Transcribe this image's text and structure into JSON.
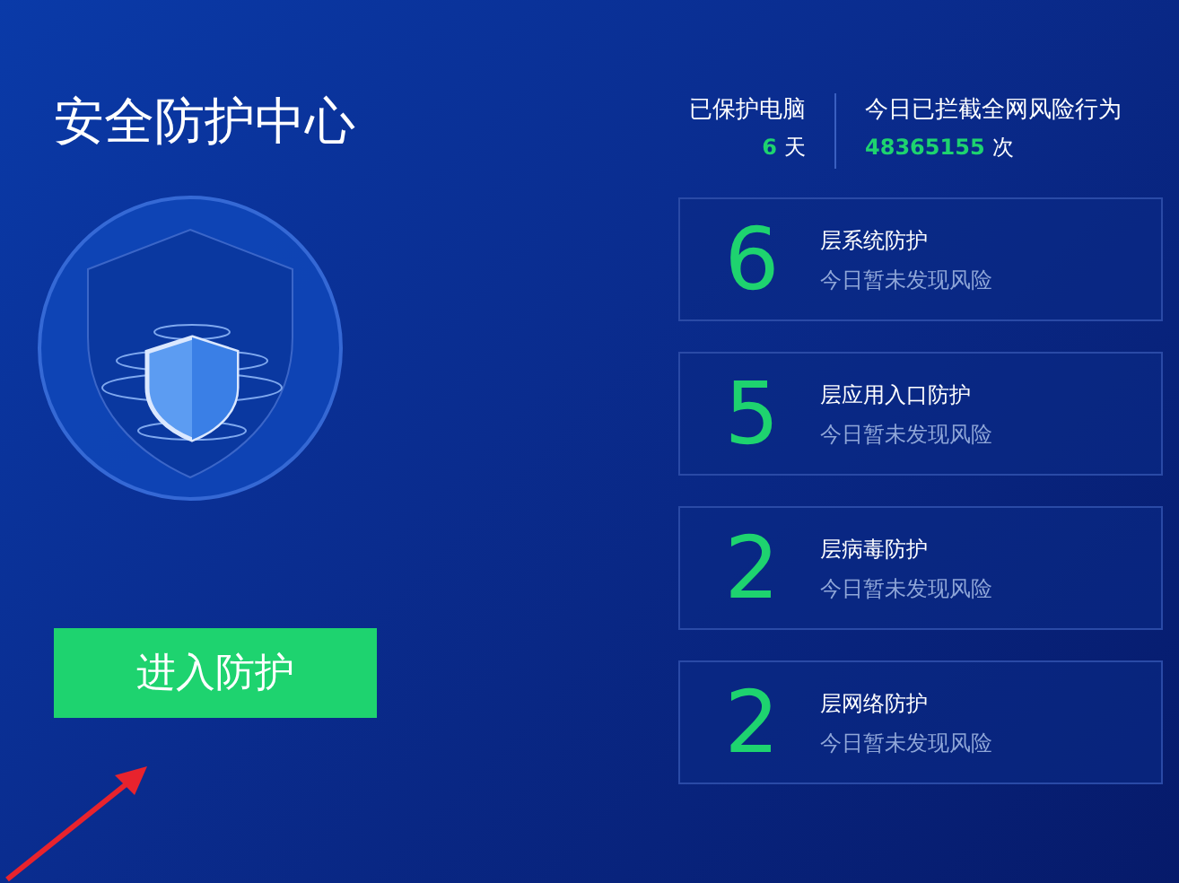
{
  "title": "安全防护中心",
  "stats": [
    {
      "label": "已保护电脑",
      "value": "6",
      "unit": "天"
    },
    {
      "label": "今日已拦截全网风险行为",
      "value": "48365155",
      "unit": "次"
    }
  ],
  "layers": [
    {
      "count": "6",
      "name": "层系统防护",
      "status": "今日暂未发现风险"
    },
    {
      "count": "5",
      "name": "层应用入口防护",
      "status": "今日暂未发现风险"
    },
    {
      "count": "2",
      "name": "层病毒防护",
      "status": "今日暂未发现风险"
    },
    {
      "count": "2",
      "name": "层网络防护",
      "status": "今日暂未发现风险"
    }
  ],
  "enter_button": "进入防护"
}
